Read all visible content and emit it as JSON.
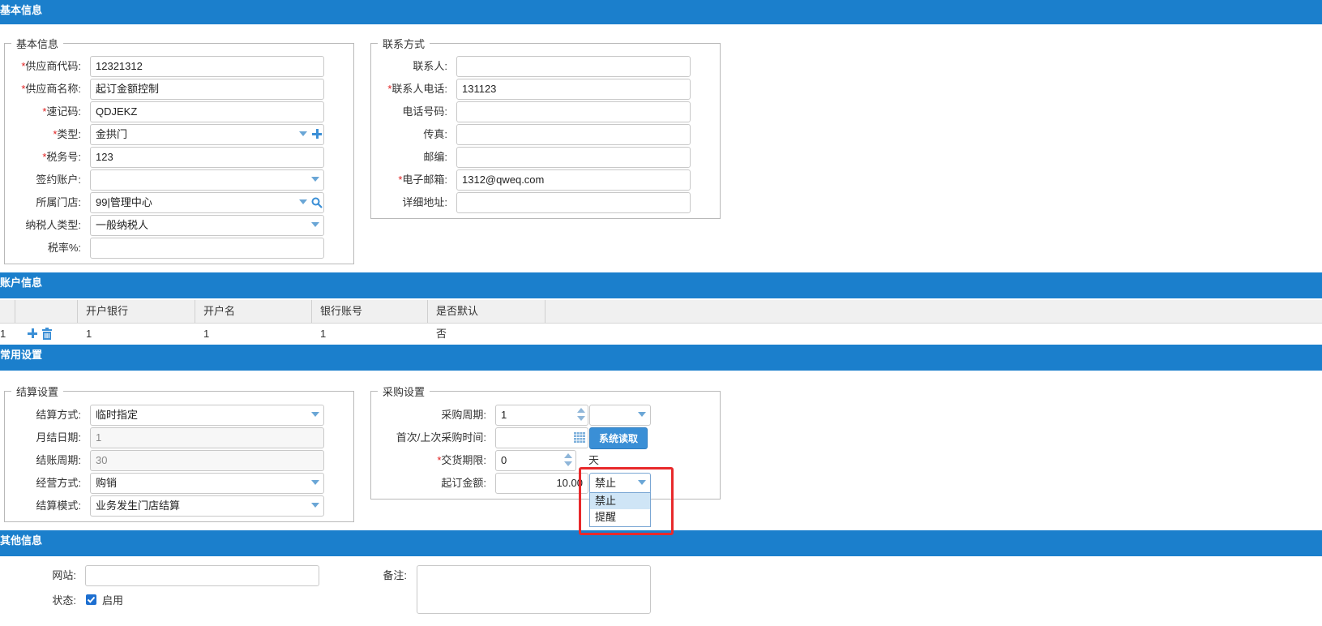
{
  "sections": {
    "basic": "基本信息",
    "account": "账户信息",
    "common": "常用设置",
    "other": "其他信息"
  },
  "basic_info": {
    "legend": "基本信息",
    "fields": [
      {
        "label": "供应商代码:",
        "required": true,
        "value": "12321312"
      },
      {
        "label": "供应商名称:",
        "required": true,
        "value": "起订金额控制"
      },
      {
        "label": "速记码:",
        "required": true,
        "value": "QDJEKZ"
      },
      {
        "label": "类型:",
        "required": true,
        "value": "金拱门"
      },
      {
        "label": "税务号:",
        "required": true,
        "value": "123"
      },
      {
        "label": "签约账户:",
        "required": false,
        "value": ""
      },
      {
        "label": "所属门店:",
        "required": false,
        "value": "99|管理中心"
      },
      {
        "label": "纳税人类型:",
        "required": false,
        "value": "一般纳税人"
      },
      {
        "label": "税率%:",
        "required": false,
        "value": ""
      }
    ]
  },
  "contact": {
    "legend": "联系方式",
    "fields": [
      {
        "label": "联系人:",
        "required": false,
        "value": ""
      },
      {
        "label": "联系人电话:",
        "required": true,
        "value": "131123"
      },
      {
        "label": "电话号码:",
        "required": false,
        "value": ""
      },
      {
        "label": "传真:",
        "required": false,
        "value": ""
      },
      {
        "label": "邮编:",
        "required": false,
        "value": ""
      },
      {
        "label": "电子邮箱:",
        "required": true,
        "value": "1312@qweq.com"
      },
      {
        "label": "详细地址:",
        "required": false,
        "value": ""
      }
    ]
  },
  "account_grid": {
    "headers": [
      "开户银行",
      "开户名",
      "银行账号",
      "是否默认"
    ],
    "rows": [
      {
        "index": "1",
        "cells": [
          "1",
          "1",
          "1",
          "否"
        ]
      }
    ]
  },
  "settlement": {
    "legend": "结算设置",
    "fields": [
      {
        "label": "结算方式:",
        "value": "临时指定",
        "disabled": false
      },
      {
        "label": "月结日期:",
        "value": "1",
        "disabled": true
      },
      {
        "label": "结账周期:",
        "value": "30",
        "disabled": true
      },
      {
        "label": "经营方式:",
        "value": "购销",
        "disabled": false
      },
      {
        "label": "结算模式:",
        "value": "业务发生门店结算",
        "disabled": false
      }
    ]
  },
  "purchase": {
    "legend": "采购设置",
    "cycle_label": "采购周期:",
    "cycle_value": "1",
    "cycle_unit": "",
    "last_time_label": "首次/上次采购时间:",
    "last_time_value": "",
    "system_read_btn": "系统读取",
    "delivery_label": "交货期限:",
    "delivery_value": "0",
    "delivery_unit": "天",
    "min_amount_label": "起订金额:",
    "min_amount_value": "10.00",
    "control_value": "禁止",
    "control_options": [
      "禁止",
      "提醒"
    ]
  },
  "other_info": {
    "website_label": "网站:",
    "website_value": "",
    "remark_label": "备注:",
    "remark_value": "",
    "status_label": "状态:",
    "status_enabled_label": "启用",
    "status_checked": true
  }
}
